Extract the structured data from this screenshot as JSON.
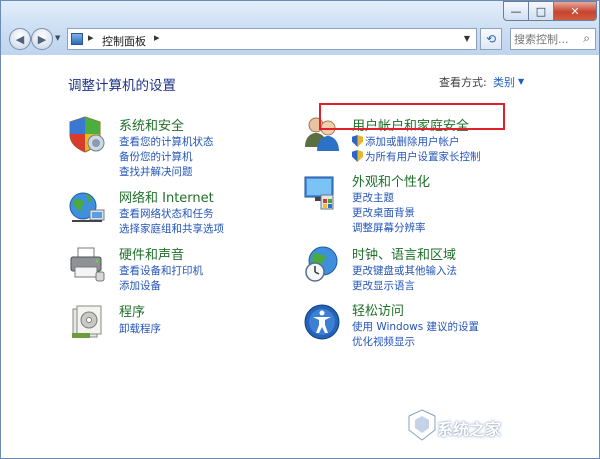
{
  "window": {
    "buttons": {
      "minimize": "—",
      "maximize": "□",
      "close": "✕"
    }
  },
  "nav": {
    "back_icon": "◀",
    "forward_icon": "▶",
    "history_dropdown": "▼",
    "breadcrumb": "控制面板",
    "crumb_sep": "▸",
    "address_dropdown": "▼",
    "refresh_icon": "⟲",
    "search_placeholder": "搜索控制...",
    "search_icon": "⌕"
  },
  "content": {
    "heading": "调整计算机的设置",
    "view_by_label": "查看方式:",
    "view_by_value": "类别",
    "view_by_dropdown": "▼"
  },
  "categories": {
    "system": {
      "title": "系统和安全",
      "links": [
        "查看您的计算机状态",
        "备份您的计算机",
        "查找并解决问题"
      ]
    },
    "network": {
      "title": "网络和 Internet",
      "links": [
        "查看网络状态和任务",
        "选择家庭组和共享选项"
      ]
    },
    "hardware": {
      "title": "硬件和声音",
      "links": [
        "查看设备和打印机",
        "添加设备"
      ]
    },
    "programs": {
      "title": "程序",
      "links": [
        "卸载程序"
      ]
    },
    "users": {
      "title": "用户帐户和家庭安全",
      "links": [
        "添加或删除用户帐户",
        "为所有用户设置家长控制"
      ]
    },
    "appearance": {
      "title": "外观和个性化",
      "links": [
        "更改主题",
        "更改桌面背景",
        "调整屏幕分辨率"
      ]
    },
    "clock": {
      "title": "时钟、语言和区域",
      "links": [
        "更改键盘或其他输入法",
        "更改显示语言"
      ]
    },
    "ease": {
      "title": "轻松访问",
      "links": [
        "使用 Windows 建议的设置",
        "优化视频显示"
      ]
    }
  },
  "watermark": {
    "text": "系统之家"
  },
  "colors": {
    "category_title": "#1f6f2a",
    "link": "#2455b8",
    "heading": "#1e3287",
    "highlight": "#e0202a"
  }
}
